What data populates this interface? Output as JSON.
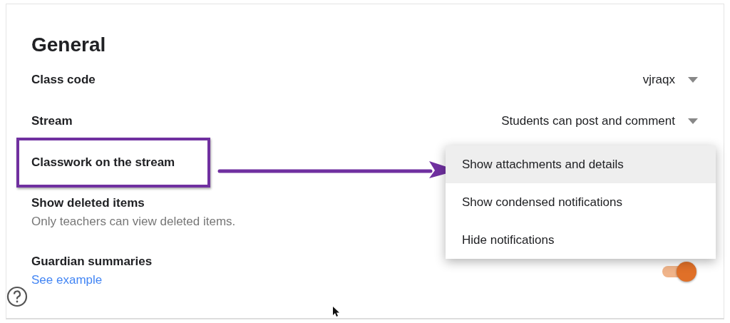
{
  "title": "General",
  "settings": [
    {
      "kind": "dropdown",
      "label": "Class code",
      "value": "vjraqx"
    },
    {
      "kind": "dropdown",
      "label": "Stream",
      "value": "Students can post and comment"
    },
    {
      "kind": "menu",
      "label": "Classwork on the stream",
      "annotated": true
    },
    {
      "kind": "plain",
      "label": "Show deleted items",
      "description": "Only teachers can view deleted items."
    },
    {
      "kind": "toggle",
      "label": "Guardian summaries",
      "link": "See example",
      "on": true
    }
  ],
  "menu": {
    "items": [
      {
        "label": "Show attachments and details",
        "selected": true
      },
      {
        "label": "Show condensed notifications",
        "selected": false
      },
      {
        "label": "Hide notifications",
        "selected": false
      }
    ]
  }
}
